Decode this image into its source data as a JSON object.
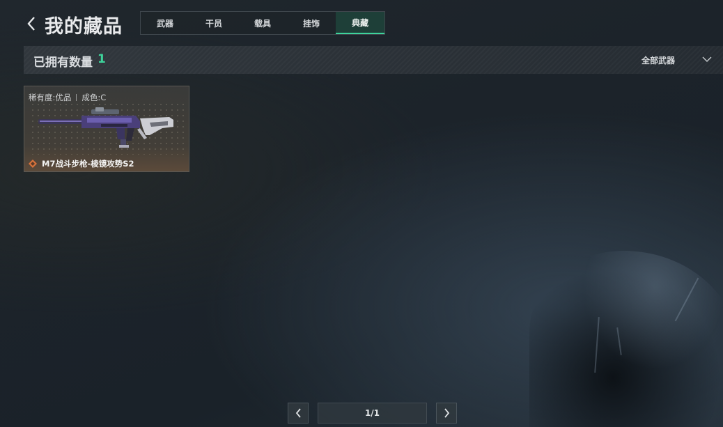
{
  "header": {
    "title": "我的藏品",
    "tabs": [
      {
        "label": "武器",
        "active": false
      },
      {
        "label": "干员",
        "active": false
      },
      {
        "label": "载具",
        "active": false
      },
      {
        "label": "挂饰",
        "active": false
      },
      {
        "label": "典藏",
        "active": true
      }
    ]
  },
  "count_bar": {
    "label": "已拥有数量",
    "value": "1",
    "filter": {
      "selected": "全部武器"
    }
  },
  "items": [
    {
      "rarity": "稀有度:优品",
      "condition": "成色:C",
      "name": "M7战斗步枪-棱镜攻势S2",
      "rarity_icon": "diamond-rarity-icon",
      "rarity_color": "#d9733b"
    }
  ],
  "pagination": {
    "indicator": "1/1"
  },
  "colors": {
    "accent": "#3ed39b",
    "active_tab_bg": "#1e3f38"
  }
}
